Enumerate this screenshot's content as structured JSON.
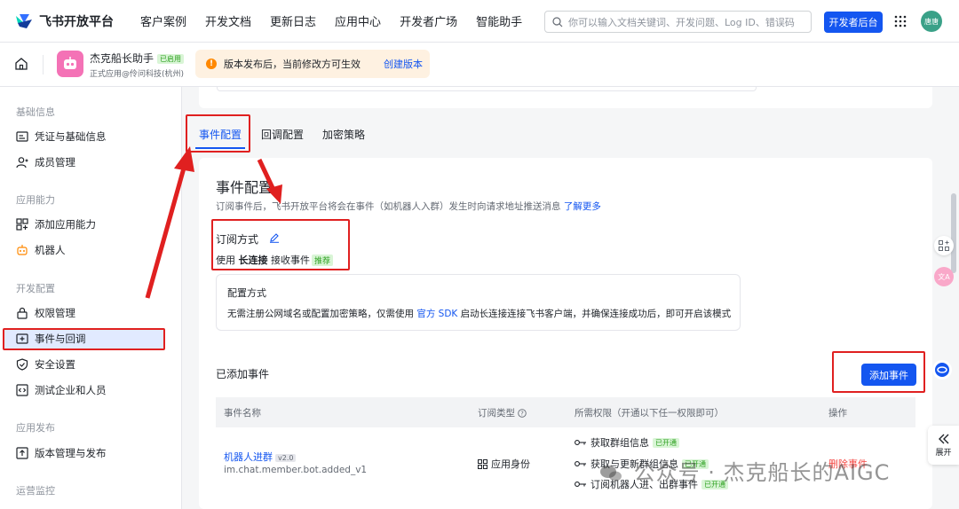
{
  "header": {
    "logo_text": "飞书开放平台",
    "nav": [
      "客户案例",
      "开发文档",
      "更新日志",
      "应用中心",
      "开发者广场",
      "智能助手"
    ],
    "search_placeholder": "你可以输入文档关键词、开发问题、Log ID、错误码",
    "console_button": "开发者后台",
    "avatar_text": "唐唐"
  },
  "appbar": {
    "app_name": "杰克船长助手",
    "app_status": "已启用",
    "app_subtitle": "正式应用@伶问科技(杭州)",
    "notice_icon": "!",
    "notice_text": "版本发布后，当前修改方可生效",
    "notice_link": "创建版本"
  },
  "sidebar": {
    "groups": [
      {
        "label": "基础信息",
        "items": [
          {
            "label": "凭证与基础信息",
            "icon": "id-card-icon"
          },
          {
            "label": "成员管理",
            "icon": "user-icon"
          }
        ]
      },
      {
        "label": "应用能力",
        "items": [
          {
            "label": "添加应用能力",
            "icon": "grid-add-icon"
          },
          {
            "label": "机器人",
            "icon": "robot-icon"
          }
        ]
      },
      {
        "label": "开发配置",
        "items": [
          {
            "label": "权限管理",
            "icon": "lock-icon"
          },
          {
            "label": "事件与回调",
            "icon": "event-icon",
            "active": true
          },
          {
            "label": "安全设置",
            "icon": "shield-icon"
          },
          {
            "label": "测试企业和人员",
            "icon": "code-icon"
          }
        ]
      },
      {
        "label": "应用发布",
        "items": [
          {
            "label": "版本管理与发布",
            "icon": "upload-icon"
          }
        ]
      },
      {
        "label": "运营监控",
        "items": []
      }
    ]
  },
  "tabs": [
    "事件配置",
    "回调配置",
    "加密策略"
  ],
  "event_config": {
    "title": "事件配置",
    "desc": "订阅事件后，飞书开放平台将会在事件（如机器人入群）发生时向请求地址推送消息",
    "desc_link": "了解更多",
    "subscribe_label": "订阅方式",
    "subscribe_prefix": "使用",
    "subscribe_mode": "长连接",
    "subscribe_suffix": "接收事件",
    "recommend_badge": "推荐",
    "config_title": "配置方式",
    "config_text_before": "无需注册公网域名或配置加密策略，仅需使用",
    "config_link": "官方 SDK",
    "config_text_after": "启动长连接连接飞书客户端，并确保连接成功后，即可开启该模式"
  },
  "added_events": {
    "title": "已添加事件",
    "add_button": "添加事件",
    "columns": [
      "事件名称",
      "订阅类型",
      "所需权限（开通以下任一权限即可）",
      "操作"
    ],
    "rows": [
      {
        "name": "机器人进群",
        "version": "v2.0",
        "code": "im.chat.member.bot.added_v1",
        "type": "应用身份",
        "permissions": [
          {
            "label": "获取群组信息",
            "status": "已开通"
          },
          {
            "label": "获取与更新群组信息",
            "status": "已开通"
          },
          {
            "label": "订阅机器人进、出群事件",
            "status": "已开通"
          }
        ],
        "action": "删除事件"
      }
    ]
  },
  "float": {
    "expand_label": "展开",
    "translate_label": "文A"
  },
  "watermark": "公众号 · 杰克船长的AIGC",
  "colors": {
    "primary": "#1456f0",
    "annotation": "#e02020",
    "success": "#2ea121",
    "danger": "#f54a45"
  }
}
